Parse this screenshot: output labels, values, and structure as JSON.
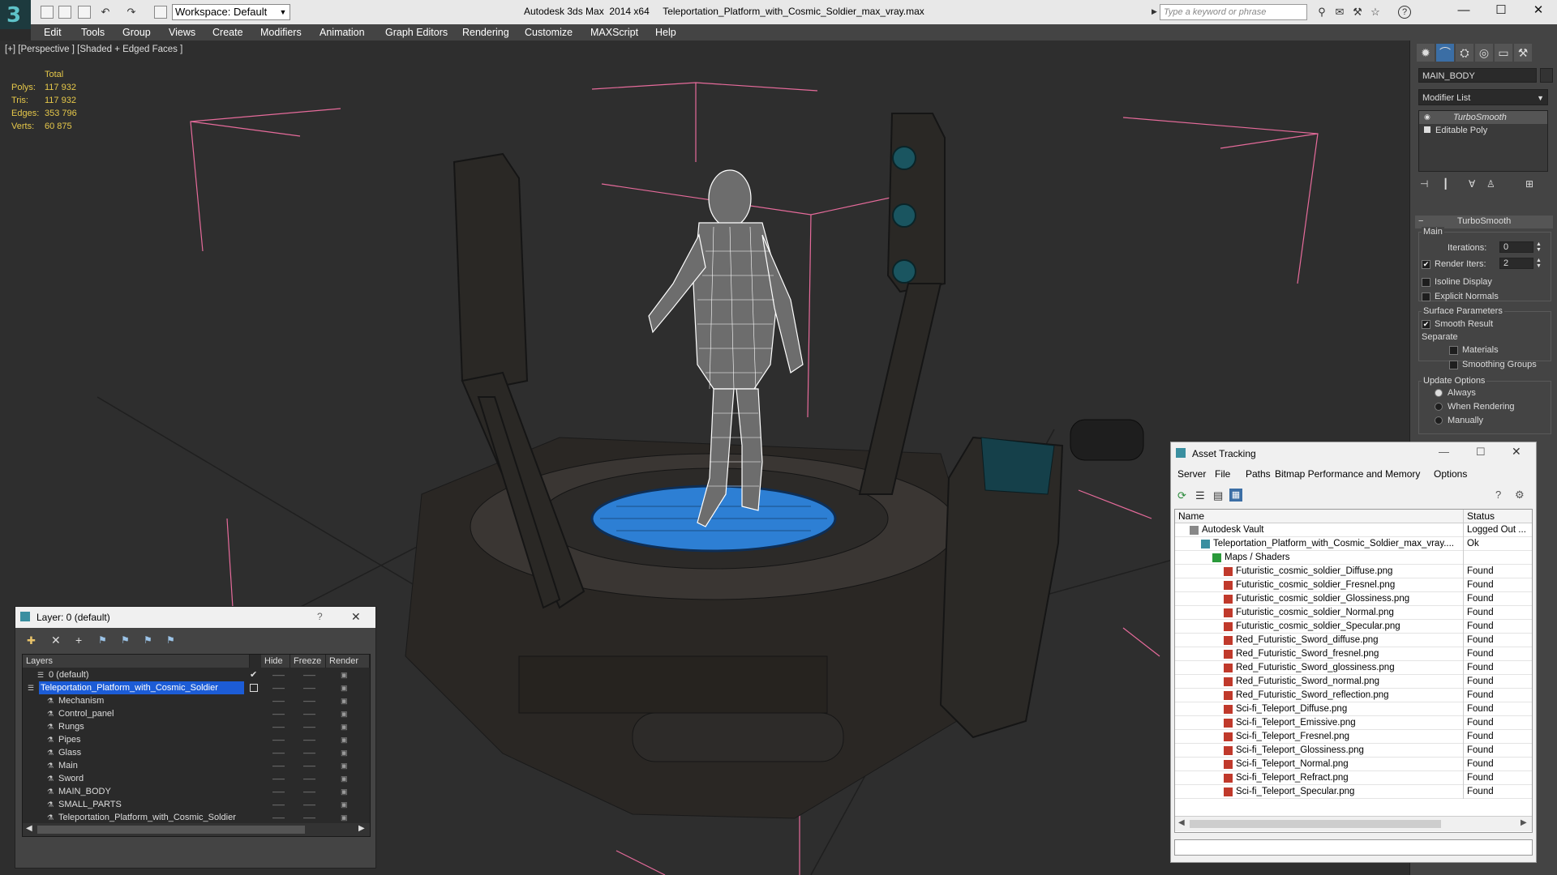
{
  "app": {
    "title": "Autodesk 3ds Max  2014 x64     Teleportation_Platform_with_Cosmic_Soldier_max_vray.max",
    "logo": "3",
    "workspace": "Workspace: Default",
    "search_placeholder": "Type a keyword or phrase"
  },
  "menu": [
    "Edit",
    "Tools",
    "Group",
    "Views",
    "Create",
    "Modifiers",
    "Animation",
    "Graph Editors",
    "Rendering",
    "Customize",
    "MAXScript",
    "Help"
  ],
  "viewport": {
    "label": "[+] [Perspective ] [Shaded + Edged Faces ]",
    "stats": {
      "header": "Total",
      "rows": [
        {
          "label": "Polys:",
          "value": "117 932"
        },
        {
          "label": "Tris:",
          "value": "117 932"
        },
        {
          "label": "Edges:",
          "value": "353 796"
        },
        {
          "label": "Verts:",
          "value": "60 875"
        }
      ]
    }
  },
  "command_panel": {
    "object_name": "MAIN_BODY",
    "modifier_list": "Modifier List",
    "stack": [
      {
        "label": "TurboSmooth",
        "italic": true
      },
      {
        "label": "Editable Poly",
        "italic": false
      }
    ],
    "rollout_title": "TurboSmooth",
    "main_group": "Main",
    "iterations_label": "Iterations:",
    "iterations_value": "0",
    "render_iters_label": "Render Iters:",
    "render_iters_value": "2",
    "render_iters_checked": true,
    "isoline": "Isoline Display",
    "explicit_normals": "Explicit Normals",
    "surface_params": "Surface Parameters",
    "smooth_result": "Smooth Result",
    "separate": "Separate",
    "materials": "Materials",
    "smoothing_groups": "Smoothing Groups",
    "update_options": "Update Options",
    "always": "Always",
    "when_rendering": "When Rendering",
    "manually": "Manually"
  },
  "layer_dialog": {
    "title": "Layer: 0 (default)",
    "help": "?",
    "columns": [
      "Layers",
      "Hide",
      "Freeze",
      "Render"
    ],
    "rows": [
      {
        "name": "0 (default)",
        "level": 1,
        "selected": false,
        "active": true
      },
      {
        "name": "Teleportation_Platform_with_Cosmic_Soldier",
        "level": 0,
        "selected": true,
        "active": false
      },
      {
        "name": "Mechanism",
        "level": 2,
        "selected": false,
        "active": false
      },
      {
        "name": "Control_panel",
        "level": 2,
        "selected": false,
        "active": false
      },
      {
        "name": "Rungs",
        "level": 2,
        "selected": false,
        "active": false
      },
      {
        "name": "Pipes",
        "level": 2,
        "selected": false,
        "active": false
      },
      {
        "name": "Glass",
        "level": 2,
        "selected": false,
        "active": false
      },
      {
        "name": "Main",
        "level": 2,
        "selected": false,
        "active": false
      },
      {
        "name": "Sword",
        "level": 2,
        "selected": false,
        "active": false
      },
      {
        "name": "MAIN_BODY",
        "level": 2,
        "selected": false,
        "active": false
      },
      {
        "name": "SMALL_PARTS",
        "level": 2,
        "selected": false,
        "active": false
      },
      {
        "name": "Teleportation_Platform_with_Cosmic_Soldier",
        "level": 2,
        "selected": false,
        "active": false
      }
    ]
  },
  "asset_dialog": {
    "title": "Asset Tracking",
    "menu": [
      "Server",
      "File",
      "Paths",
      "Bitmap Performance and Memory",
      "Options"
    ],
    "columns": [
      "Name",
      "Status"
    ],
    "rows": [
      {
        "name": "Autodesk Vault",
        "status": "Logged Out ...",
        "level": 0,
        "icon": "vault-icon"
      },
      {
        "name": "Teleportation_Platform_with_Cosmic_Soldier_max_vray....",
        "status": "Ok",
        "level": 1,
        "icon": "max-file-icon"
      },
      {
        "name": "Maps / Shaders",
        "status": "",
        "level": 2,
        "icon": "maps-folder-icon"
      },
      {
        "name": "Futuristic_cosmic_soldier_Diffuse.png",
        "status": "Found",
        "level": 3,
        "icon": "png-file-icon"
      },
      {
        "name": "Futuristic_cosmic_soldier_Fresnel.png",
        "status": "Found",
        "level": 3,
        "icon": "png-file-icon"
      },
      {
        "name": "Futuristic_cosmic_soldier_Glossiness.png",
        "status": "Found",
        "level": 3,
        "icon": "png-file-icon"
      },
      {
        "name": "Futuristic_cosmic_soldier_Normal.png",
        "status": "Found",
        "level": 3,
        "icon": "png-file-icon"
      },
      {
        "name": "Futuristic_cosmic_soldier_Specular.png",
        "status": "Found",
        "level": 3,
        "icon": "png-file-icon"
      },
      {
        "name": "Red_Futuristic_Sword_diffuse.png",
        "status": "Found",
        "level": 3,
        "icon": "png-file-icon"
      },
      {
        "name": "Red_Futuristic_Sword_fresnel.png",
        "status": "Found",
        "level": 3,
        "icon": "png-file-icon"
      },
      {
        "name": "Red_Futuristic_Sword_glossiness.png",
        "status": "Found",
        "level": 3,
        "icon": "png-file-icon"
      },
      {
        "name": "Red_Futuristic_Sword_normal.png",
        "status": "Found",
        "level": 3,
        "icon": "png-file-icon"
      },
      {
        "name": "Red_Futuristic_Sword_reflection.png",
        "status": "Found",
        "level": 3,
        "icon": "png-file-icon"
      },
      {
        "name": "Sci-fi_Teleport_Diffuse.png",
        "status": "Found",
        "level": 3,
        "icon": "png-file-icon"
      },
      {
        "name": "Sci-fi_Teleport_Emissive.png",
        "status": "Found",
        "level": 3,
        "icon": "png-file-icon"
      },
      {
        "name": "Sci-fi_Teleport_Fresnel.png",
        "status": "Found",
        "level": 3,
        "icon": "png-file-icon"
      },
      {
        "name": "Sci-fi_Teleport_Glossiness.png",
        "status": "Found",
        "level": 3,
        "icon": "png-file-icon"
      },
      {
        "name": "Sci-fi_Teleport_Normal.png",
        "status": "Found",
        "level": 3,
        "icon": "png-file-icon"
      },
      {
        "name": "Sci-fi_Teleport_Refract.png",
        "status": "Found",
        "level": 3,
        "icon": "png-file-icon"
      },
      {
        "name": "Sci-fi_Teleport_Specular.png",
        "status": "Found",
        "level": 3,
        "icon": "png-file-icon"
      }
    ]
  },
  "colors": {
    "stat_text": "#e6c84a",
    "selection": "#1c5cd6",
    "wireframe": "#ffffff",
    "platform_glow": "#2d7fd4",
    "accent_cyan": "#5ec2c8"
  }
}
